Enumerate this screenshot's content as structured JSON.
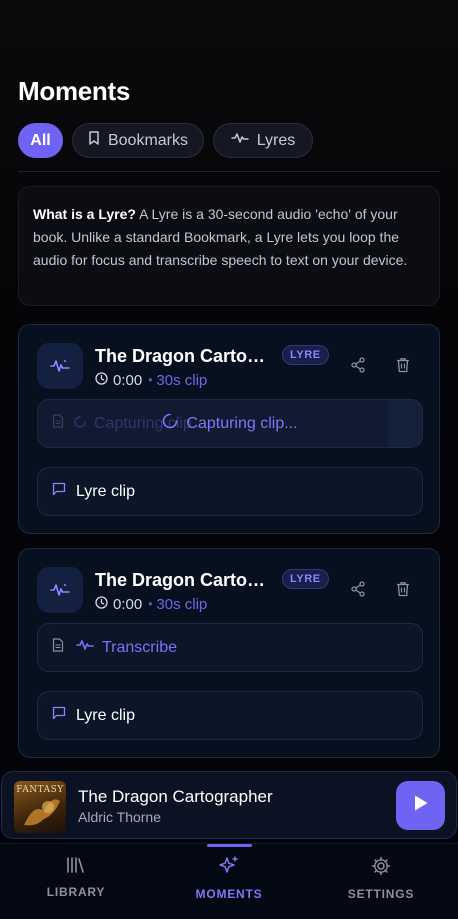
{
  "page": {
    "title": "Moments"
  },
  "filters": [
    {
      "label": "All",
      "icon": "none",
      "active": true
    },
    {
      "label": "Bookmarks",
      "icon": "bookmark-icon",
      "active": false
    },
    {
      "label": "Lyres",
      "icon": "waveform-icon",
      "active": false
    }
  ],
  "info": {
    "heading": "What is a Lyre?",
    "body": "A Lyre is a 30-second audio 'echo' of your book. Unlike a standard Bookmark, a Lyre lets you loop the audio for focus and transcribe speech to text on your device."
  },
  "moments": [
    {
      "title": "The Dragon Cartographer",
      "badge": "LYRE",
      "time": "0:00",
      "clip_length": "30s clip",
      "action_state": "capturing",
      "capturing_label": "Capturing clip...",
      "ghost_label": "Capturing clip...",
      "clip_label": "Lyre clip"
    },
    {
      "title": "The Dragon Cartographer",
      "badge": "LYRE",
      "time": "0:00",
      "clip_length": "30s clip",
      "action_state": "ready",
      "transcribe_label": "Transcribe",
      "clip_label": "Lyre clip"
    }
  ],
  "player": {
    "title": "The Dragon Cartographer",
    "author": "Aldric Thorne",
    "cover_text": "FANTASY"
  },
  "nav": [
    {
      "label": "LIBRARY",
      "icon": "library-icon",
      "active": false
    },
    {
      "label": "MOMENTS",
      "icon": "sparkle-icon",
      "active": true
    },
    {
      "label": "SETTINGS",
      "icon": "gear-icon",
      "active": false
    }
  ],
  "colors": {
    "accent": "#6e63f2",
    "accent_text": "#7d78f5",
    "background": "#050508",
    "card": "#07101f"
  }
}
